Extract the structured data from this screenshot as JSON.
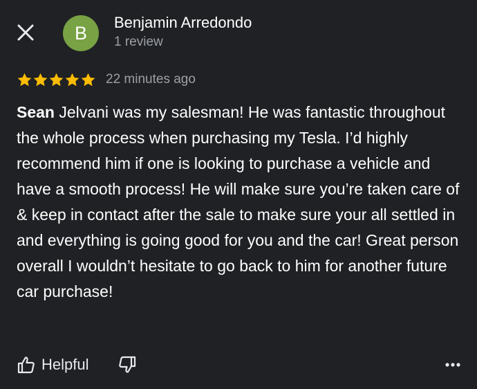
{
  "header": {
    "close_icon": "close-icon"
  },
  "reviewer": {
    "avatar_letter": "B",
    "avatar_color": "#78a244",
    "name": "Benjamin Arredondo",
    "review_count": "1 review"
  },
  "review": {
    "rating": 5,
    "rating_max": 5,
    "star_color": "#fbbc04",
    "time_ago": "22 minutes ago",
    "text_first_word": "Sean",
    "text_rest": " Jelvani was my salesman! He was fantastic throughout the whole process when purchasing my Tesla. I’d highly recommend him if one is looking to purchase a vehicle and have a smooth process! He will make sure you’re taken care of & keep in contact after the sale to make sure your all settled in and everything is going good for you and the car! Great person overall I wouldn’t hesitate to go back to him for another future car purchase!"
  },
  "actions": {
    "helpful_label": "Helpful",
    "helpful_icon": "thumbs-up-icon",
    "not_helpful_icon": "thumbs-down-icon",
    "more_icon": "more-options-icon"
  }
}
